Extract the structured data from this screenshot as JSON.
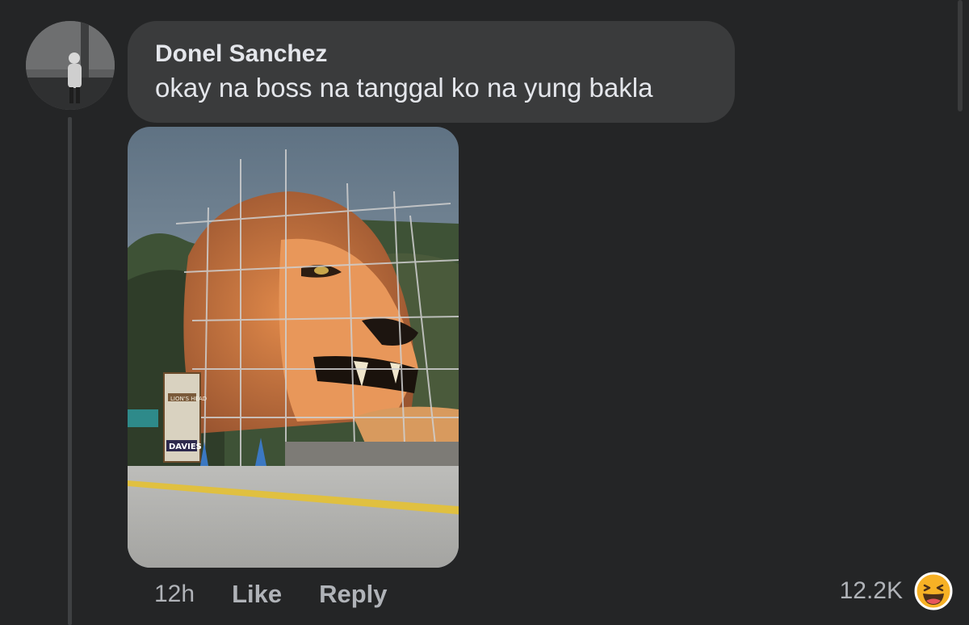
{
  "comment": {
    "author": "Donel Sanchez",
    "text": "okay na boss na tanggal ko na yung bakla",
    "timestamp": "12h",
    "like_label": "Like",
    "reply_label": "Reply",
    "reaction_count": "12.2K",
    "reaction_icon": "haha-emoji-icon"
  },
  "attachment": {
    "type": "photo",
    "sign_text": "LION'S HEAD",
    "sign_brand": "DAVIES"
  },
  "colors": {
    "background": "#242526",
    "bubble": "#3a3b3c",
    "primary_text": "#e4e6eb",
    "secondary_text": "#b0b3b8",
    "reaction_yellow": "#f7b125"
  }
}
